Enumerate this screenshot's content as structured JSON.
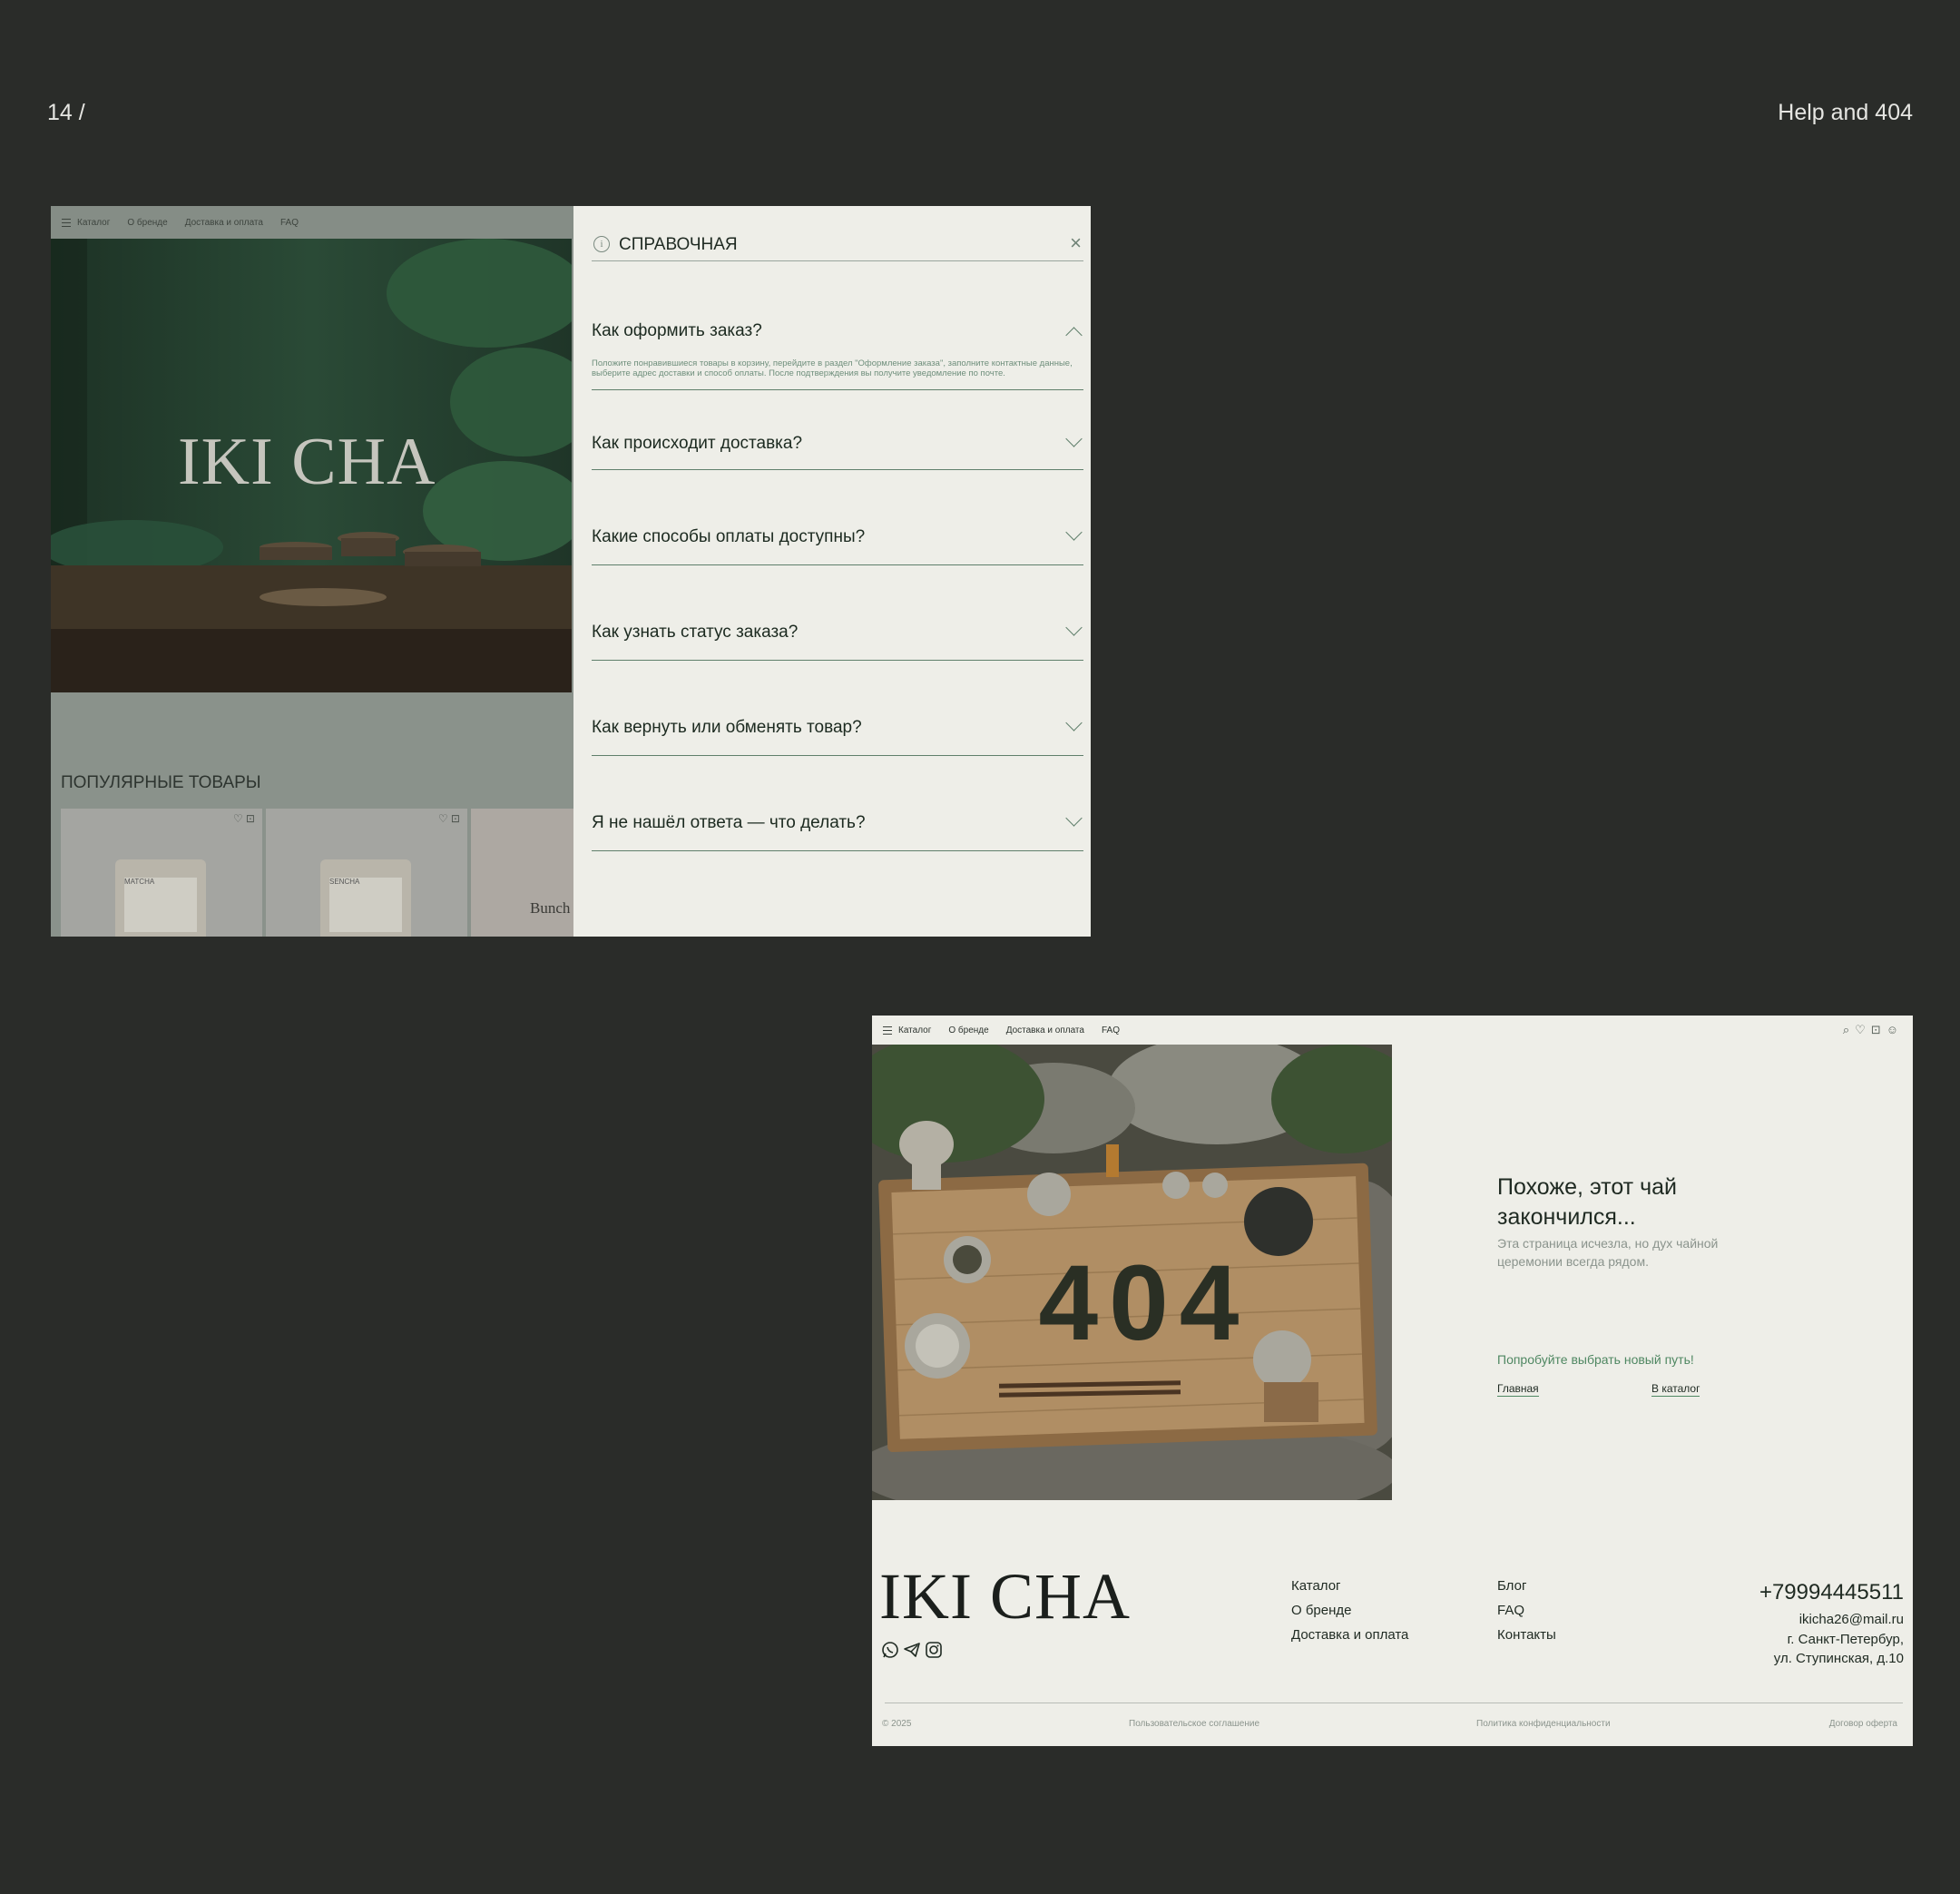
{
  "slide": {
    "number": "14 /",
    "title": "Help and 404"
  },
  "help_mockup": {
    "nav": {
      "items": [
        "Каталог",
        "О бренде",
        "Доставка и оплата",
        "FAQ"
      ]
    },
    "hero": {
      "brand": "IKI CHA"
    },
    "popular": {
      "title": "ПОПУЛЯРНЫЕ ТОВАРЫ",
      "cards": [
        {
          "label": "MATCHA"
        },
        {
          "label": "SENCHA"
        },
        {
          "label": "Bunch"
        }
      ]
    },
    "panel": {
      "title": "СПРАВОЧНАЯ",
      "faq": [
        {
          "question": "Как оформить заказ?",
          "expanded": true,
          "answer": "Положите понравившиеся товары в корзину, перейдите в раздел \"Оформление заказа\", заполните контактные данные, выберите адрес доставки и способ оплаты. После подтверждения вы получите уведомление по почте."
        },
        {
          "question": "Как происходит доставка?",
          "expanded": false
        },
        {
          "question": "Какие способы оплаты доступны?",
          "expanded": false
        },
        {
          "question": "Как узнать статус заказа?",
          "expanded": false
        },
        {
          "question": "Как вернуть или обменять товар?",
          "expanded": false
        },
        {
          "question": "Я не нашёл ответа — что делать?",
          "expanded": false
        }
      ]
    }
  },
  "notfound_mockup": {
    "nav": {
      "items": [
        "Каталог",
        "О бренде",
        "Доставка и оплата",
        "FAQ"
      ],
      "icons": [
        "search-icon",
        "heart-icon",
        "cart-icon",
        "user-icon"
      ]
    },
    "hero_text": "404",
    "title": "Похоже, этот чай закончился...",
    "subtitle": "Эта страница исчезла, но дух чайной церемонии всегда рядом.",
    "try_text": "Попробуйте выбрать новый путь!",
    "links": {
      "home": "Главная",
      "catalog": "В каталог"
    },
    "footer": {
      "brand": "IKI CHA",
      "col1": [
        "Каталог",
        "О бренде",
        "Доставка и оплата"
      ],
      "col2": [
        "Блог",
        "FAQ",
        "Контакты"
      ],
      "phone": "+79994445511",
      "email": "ikicha26@mail.ru",
      "address_line1": "г. Санкт-Петербур,",
      "address_line2": "ул. Ступинская, д.10",
      "copyright": "© 2025",
      "legal": [
        "Пользовательское соглашение",
        "Политика конфиденциальности",
        "Договор оферта"
      ]
    }
  },
  "colors": {
    "background": "#2a2c29",
    "panel": "#eeeee8",
    "accent_green": "#4f8762",
    "dark_green": "#1f3a2b"
  }
}
